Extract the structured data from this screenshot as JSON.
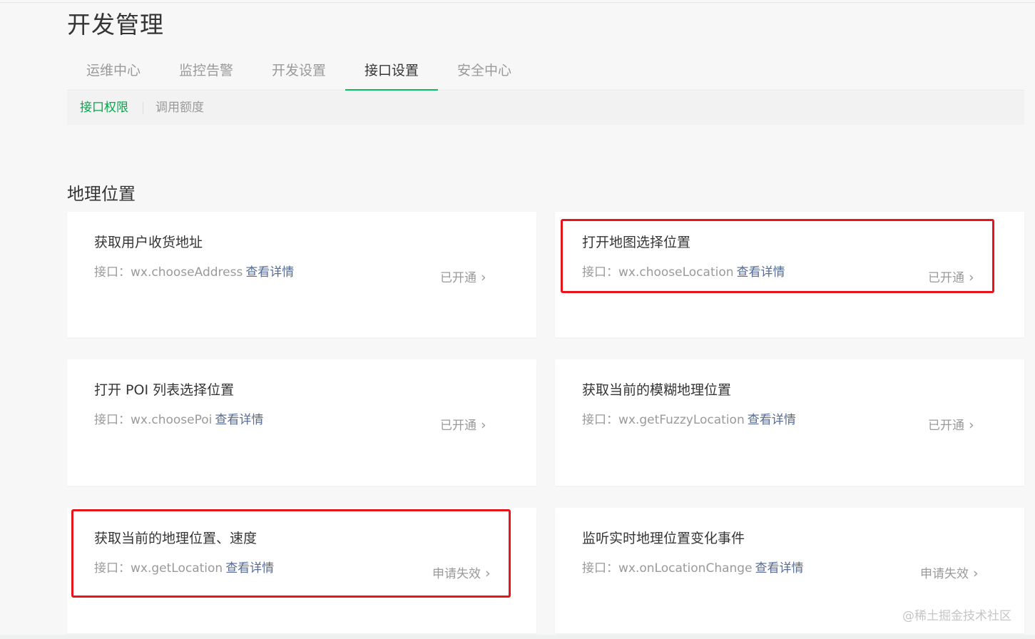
{
  "page_title": "开发管理",
  "tabs": [
    {
      "label": "运维中心"
    },
    {
      "label": "监控告警"
    },
    {
      "label": "开发设置"
    },
    {
      "label": "接口设置"
    },
    {
      "label": "安全中心"
    }
  ],
  "active_tab": "接口设置",
  "subtabs": [
    {
      "label": "接口权限"
    },
    {
      "label": "调用额度"
    }
  ],
  "section": {
    "title": "地理位置"
  },
  "api_prefix": "接口：",
  "detail_link": "查看详情",
  "cards": [
    {
      "title": "获取用户收货地址",
      "api": "wx.chooseAddress",
      "status": "已开通"
    },
    {
      "title": "打开地图选择位置",
      "api": "wx.chooseLocation",
      "status": "已开通"
    },
    {
      "title": "打开 POI 列表选择位置",
      "api": "wx.choosePoi",
      "status": "已开通"
    },
    {
      "title": "获取当前的模糊地理位置",
      "api": "wx.getFuzzyLocation",
      "status": "已开通"
    },
    {
      "title": "获取当前的地理位置、速度",
      "api": "wx.getLocation",
      "status": "申请失效"
    },
    {
      "title": "监听实时地理位置变化事件",
      "api": "wx.onLocationChange",
      "status": "申请失效"
    }
  ],
  "icons": {
    "status_chevron": "chevron-right-icon"
  },
  "colors": {
    "accent_green": "#07c160",
    "link_blue": "#576b95",
    "highlight_red": "#e8141b"
  },
  "watermark": "@稀土掘金技术社区"
}
